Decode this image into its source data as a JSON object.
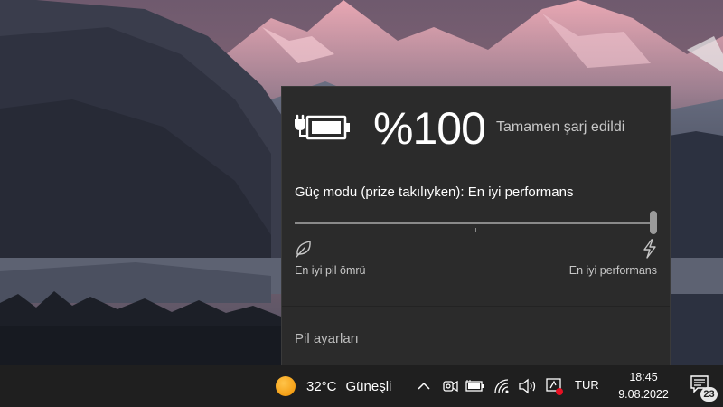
{
  "battery": {
    "percent": "%100",
    "status": "Tamamen şarj edildi",
    "power_mode": "Güç modu (prize takılıyken): En iyi performans",
    "slider_value": 1.0,
    "label_left": "En iyi pil ömrü",
    "label_right": "En iyi performans",
    "settings_link": "Pil ayarları"
  },
  "taskbar": {
    "weather_temp": "32°C",
    "weather_desc": "Güneşli",
    "language": "TUR",
    "time": "18:45",
    "date": "9.08.2022",
    "notification_count": "23",
    "icons": [
      "chevron-up-icon",
      "meet-now-icon",
      "battery-icon",
      "wifi-icon",
      "volume-icon",
      "network-alert-icon"
    ]
  },
  "colors": {
    "flyout_bg": "#2b2b2b",
    "taskbar_bg": "#1f1f1f",
    "alert_red": "#e81123",
    "sun": "#f5a623"
  }
}
